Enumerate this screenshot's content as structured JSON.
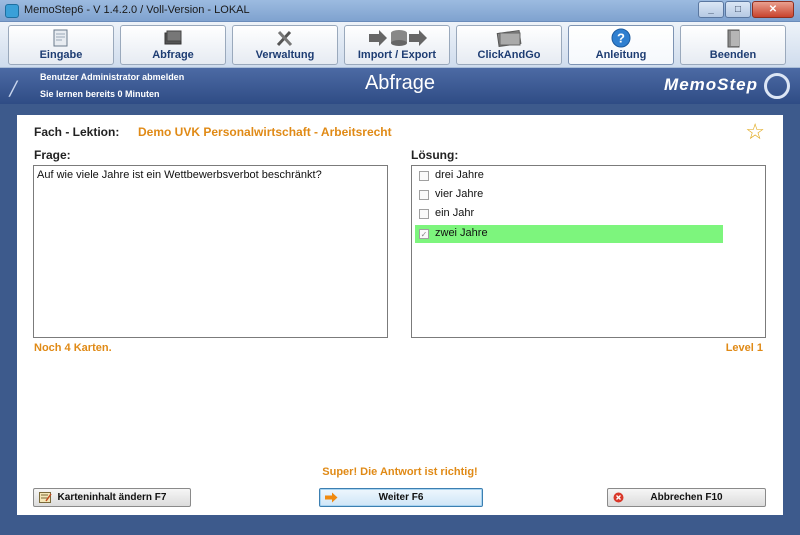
{
  "window": {
    "title": "MemoStep6 - V 1.4.2.0  /  Voll-Version  -  LOKAL",
    "min_glyph": "_",
    "max_glyph": "□",
    "close_glyph": "✕"
  },
  "toolbar": {
    "items": [
      {
        "label": "Eingabe",
        "icon": "pencil-sheet-icon"
      },
      {
        "label": "Abfrage",
        "icon": "card-stack-icon"
      },
      {
        "label": "Verwaltung",
        "icon": "tools-icon"
      },
      {
        "label": "Import / Export",
        "icon": "database-arrows-icon"
      },
      {
        "label": "ClickAndGo",
        "icon": "cards-icon"
      },
      {
        "label": "Anleitung",
        "icon": "help-icon"
      },
      {
        "label": "Beenden",
        "icon": "door-exit-icon"
      }
    ],
    "active_index": 5
  },
  "header": {
    "logout_text": "Benutzer Administrator abmelden",
    "learning_text": "Sie lernen bereits 0 Minuten",
    "page_title": "Abfrage",
    "brand": "MemoStep"
  },
  "quiz": {
    "subject_label": "Fach - Lektion:",
    "subject_value": "Demo UVK Personalwirtschaft - Arbeitsrecht",
    "question_label": "Frage:",
    "question_text": "Auf wie viele Jahre ist ein Wettbewerbsverbot beschränkt?",
    "answer_label": "Lösung:",
    "options": [
      {
        "text": "drei Jahre",
        "checked": false,
        "correct": false
      },
      {
        "text": "vier Jahre",
        "checked": false,
        "correct": false
      },
      {
        "text": "ein Jahr",
        "checked": false,
        "correct": false
      },
      {
        "text": "zwei Jahre",
        "checked": true,
        "correct": true
      }
    ],
    "cards_left": "Noch 4 Karten.",
    "level": "Level 1",
    "feedback": "Super! Die Antwort ist richtig!"
  },
  "buttons": {
    "edit_label": "Karteninhalt ändern  F7",
    "next_label": "Weiter  F6",
    "cancel_label": "Abbrechen  F10"
  },
  "colors": {
    "accent_orange": "#e08a16",
    "correct_green": "#7df57d",
    "header_blue": "#2f4c85"
  }
}
